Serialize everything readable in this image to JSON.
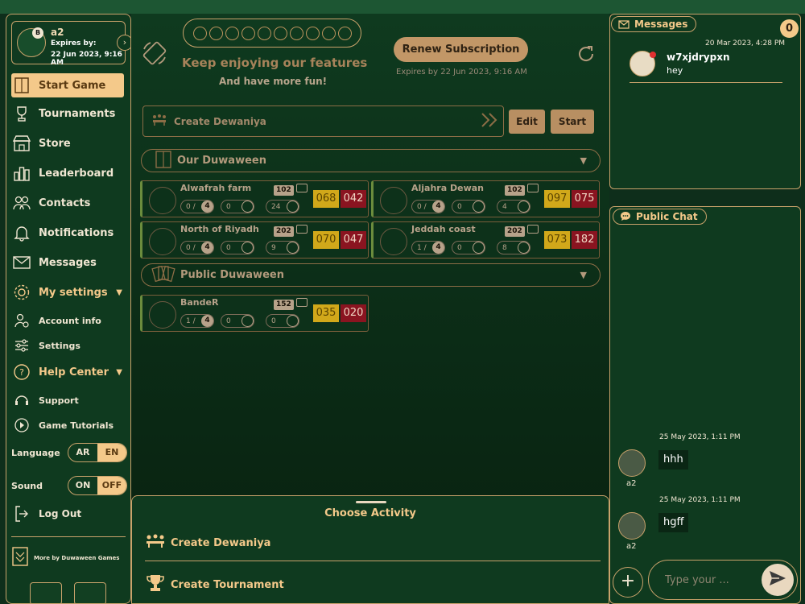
{
  "profile": {
    "name": "a2",
    "badge": "B",
    "expires_label": "Expires by:",
    "expires_date": "22 Jun 2023, 9:16 AM"
  },
  "nav": {
    "start_game": "Start Game",
    "tournaments": "Tournaments",
    "store": "Store",
    "leaderboard": "Leaderboard",
    "contacts": "Contacts",
    "notifications": "Notifications",
    "messages": "Messages",
    "my_settings": "My settings",
    "account_info": "Account info",
    "settings": "Settings",
    "help_center": "Help Center",
    "support": "Support",
    "game_tutorials": "Game Tutorials",
    "log_out": "Log Out"
  },
  "language": {
    "label": "Language",
    "ar": "AR",
    "en": "EN",
    "selected": "EN"
  },
  "sound": {
    "label": "Sound",
    "on": "ON",
    "off": "OFF",
    "selected": "OFF"
  },
  "more_games": "More by Duwaween Games",
  "promo": {
    "line1": "Keep enjoying our features",
    "line2": "And have more fun!",
    "renew_button": "Renew Subscription",
    "expires": "Expires by 22 Jun 2023, 9:16 AM"
  },
  "create_dewaniya": {
    "label": "Create Dewaniya",
    "edit": "Edit",
    "start": "Start"
  },
  "sections": {
    "our": "Our Duwaween",
    "public": "Public Duwaween"
  },
  "our_duwaween": [
    {
      "name": "Alwafrah farm",
      "id": "102",
      "players": "0 /",
      "max": "4",
      "count2": "0",
      "viewers": "24",
      "score_yellow": "068",
      "score_red": "042"
    },
    {
      "name": "Aljahra Dewan",
      "id": "102",
      "players": "0 /",
      "max": "4",
      "count2": "0",
      "viewers": "4",
      "score_yellow": "097",
      "score_red": "075"
    },
    {
      "name": "North of Riyadh",
      "id": "202",
      "players": "0 /",
      "max": "4",
      "count2": "0",
      "viewers": "9",
      "score_yellow": "070",
      "score_red": "047"
    },
    {
      "name": "Jeddah coast",
      "id": "202",
      "players": "1 /",
      "max": "4",
      "count2": "0",
      "viewers": "8",
      "score_yellow": "073",
      "score_red": "182"
    }
  ],
  "public_duwaween": [
    {
      "name": "BandeR",
      "id": "152",
      "players": "1 /",
      "max": "4",
      "count2": "0",
      "viewers": "0",
      "score_yellow": "035",
      "score_red": "020"
    }
  ],
  "activity": {
    "title": "Choose Activity",
    "create_dewaniya": "Create Dewaniya",
    "create_tournament": "Create Tournament"
  },
  "messages": {
    "title": "Messages",
    "count": "0",
    "date": "20 Mar 2023, 4:28 PM",
    "sender": "w7xjdrypxn",
    "text": "hey"
  },
  "public_chat": {
    "title": "Public Chat",
    "items": [
      {
        "date": "25 May 2023, 1:11 PM",
        "user": "a2",
        "text": "hhh"
      },
      {
        "date": "25 May 2023, 1:11 PM",
        "user": "a2",
        "text": "hgff"
      }
    ],
    "placeholder": "Type your ..."
  },
  "colors": {
    "gold": "#f4c98a",
    "green_bg": "#0f3a1f",
    "yellow_score": "#d1a81a",
    "red_score": "#8a1420"
  }
}
